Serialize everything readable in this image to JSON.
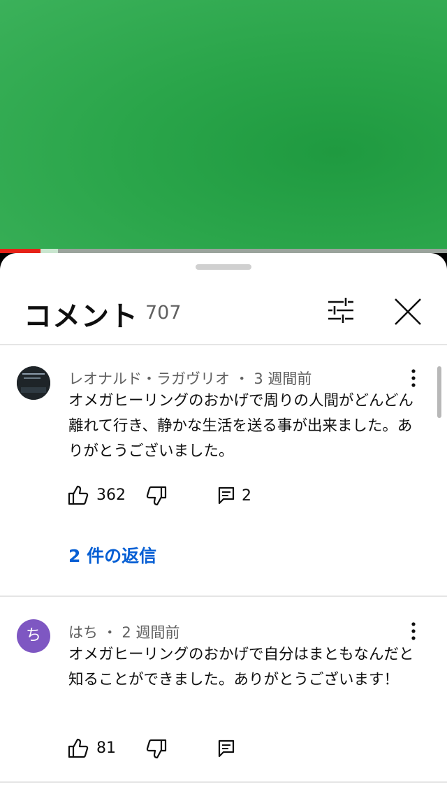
{
  "player": {
    "progress_fraction": 0.09,
    "buffered_fraction": 0.13
  },
  "header": {
    "title": "コメント",
    "count": "707"
  },
  "comments": [
    {
      "author": "レオナルド・ラガヴリオ",
      "separator": "・",
      "time": "3 週間前",
      "text": "オメガヒーリングのおかげで周りの人間がどんどん離れて行き、静かな生活を送る事が出来ました。ありがとうございました。",
      "likes": "362",
      "reply_count": "2",
      "replies_link": "2 件の返信"
    },
    {
      "author": "はち",
      "avatar_letter": "ち",
      "separator": "・",
      "time": "2 週間前",
      "text": "オメガヒーリングのおかげで自分はまともなんだと知ることができました。ありがとうございます！",
      "likes": "81"
    }
  ]
}
